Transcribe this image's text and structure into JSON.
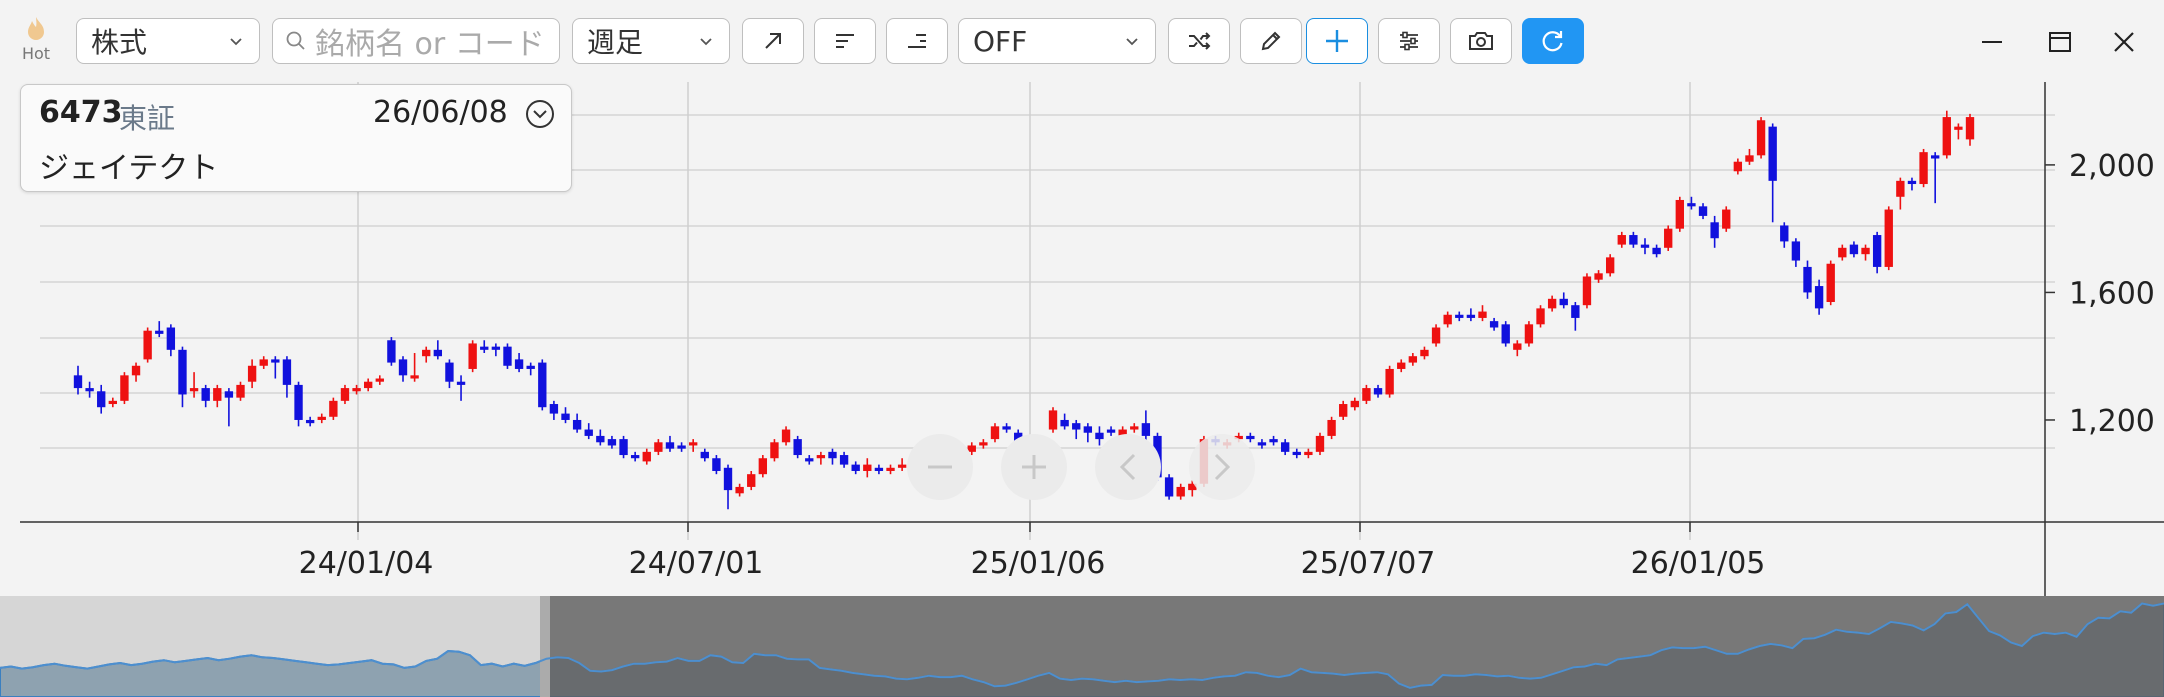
{
  "toolbar": {
    "hot_label": "Hot",
    "market_select": "株式",
    "search_placeholder": "銘柄名 or コード",
    "period_select": "週足",
    "indicator_select": "OFF"
  },
  "info_card": {
    "code": "6473",
    "market": "東証",
    "date": "26/06/08",
    "name": "ジェイテクト"
  },
  "colors": {
    "up": "#ee1111",
    "down": "#1111dd",
    "accent": "#2196f3"
  },
  "chart_data": {
    "type": "candlestick",
    "x_ticks": [
      "24/01/04",
      "24/07/01",
      "25/01/06",
      "25/07/07",
      "26/01/05"
    ],
    "y_ticks": [
      1200,
      1600,
      2000
    ],
    "ylim": [
      880,
      2260
    ],
    "grid": true,
    "candles": [
      {
        "o": 1340,
        "c": 1300,
        "h": 1370,
        "l": 1280
      },
      {
        "o": 1300,
        "c": 1290,
        "h": 1320,
        "l": 1270
      },
      {
        "o": 1290,
        "c": 1240,
        "h": 1310,
        "l": 1220
      },
      {
        "o": 1250,
        "c": 1260,
        "h": 1270,
        "l": 1240
      },
      {
        "o": 1260,
        "c": 1340,
        "h": 1350,
        "l": 1250
      },
      {
        "o": 1340,
        "c": 1370,
        "h": 1380,
        "l": 1320
      },
      {
        "o": 1390,
        "c": 1480,
        "h": 1490,
        "l": 1380
      },
      {
        "o": 1480,
        "c": 1470,
        "h": 1510,
        "l": 1460
      },
      {
        "o": 1490,
        "c": 1420,
        "h": 1500,
        "l": 1400
      },
      {
        "o": 1420,
        "c": 1280,
        "h": 1430,
        "l": 1240
      },
      {
        "o": 1290,
        "c": 1300,
        "h": 1350,
        "l": 1270
      },
      {
        "o": 1300,
        "c": 1260,
        "h": 1310,
        "l": 1240
      },
      {
        "o": 1260,
        "c": 1300,
        "h": 1310,
        "l": 1240
      },
      {
        "o": 1290,
        "c": 1270,
        "h": 1300,
        "l": 1180
      },
      {
        "o": 1270,
        "c": 1310,
        "h": 1320,
        "l": 1260
      },
      {
        "o": 1320,
        "c": 1370,
        "h": 1390,
        "l": 1300
      },
      {
        "o": 1370,
        "c": 1390,
        "h": 1400,
        "l": 1360
      },
      {
        "o": 1390,
        "c": 1380,
        "h": 1400,
        "l": 1330
      },
      {
        "o": 1390,
        "c": 1310,
        "h": 1400,
        "l": 1270
      },
      {
        "o": 1310,
        "c": 1200,
        "h": 1320,
        "l": 1180
      },
      {
        "o": 1200,
        "c": 1190,
        "h": 1210,
        "l": 1180
      },
      {
        "o": 1200,
        "c": 1210,
        "h": 1220,
        "l": 1190
      },
      {
        "o": 1210,
        "c": 1260,
        "h": 1270,
        "l": 1200
      },
      {
        "o": 1260,
        "c": 1300,
        "h": 1310,
        "l": 1250
      },
      {
        "o": 1290,
        "c": 1300,
        "h": 1310,
        "l": 1280
      },
      {
        "o": 1300,
        "c": 1320,
        "h": 1330,
        "l": 1290
      },
      {
        "o": 1320,
        "c": 1330,
        "h": 1340,
        "l": 1310
      },
      {
        "o": 1450,
        "c": 1380,
        "h": 1460,
        "l": 1370
      },
      {
        "o": 1390,
        "c": 1340,
        "h": 1400,
        "l": 1320
      },
      {
        "o": 1330,
        "c": 1340,
        "h": 1410,
        "l": 1320
      },
      {
        "o": 1400,
        "c": 1420,
        "h": 1430,
        "l": 1380
      },
      {
        "o": 1420,
        "c": 1400,
        "h": 1450,
        "l": 1390
      },
      {
        "o": 1380,
        "c": 1320,
        "h": 1390,
        "l": 1300
      },
      {
        "o": 1320,
        "c": 1310,
        "h": 1340,
        "l": 1260
      },
      {
        "o": 1360,
        "c": 1440,
        "h": 1450,
        "l": 1350
      },
      {
        "o": 1430,
        "c": 1420,
        "h": 1450,
        "l": 1410
      },
      {
        "o": 1430,
        "c": 1420,
        "h": 1440,
        "l": 1400
      },
      {
        "o": 1430,
        "c": 1370,
        "h": 1440,
        "l": 1360
      },
      {
        "o": 1390,
        "c": 1360,
        "h": 1410,
        "l": 1350
      },
      {
        "o": 1370,
        "c": 1360,
        "h": 1380,
        "l": 1340
      },
      {
        "o": 1380,
        "c": 1240,
        "h": 1390,
        "l": 1230
      },
      {
        "o": 1250,
        "c": 1220,
        "h": 1260,
        "l": 1200
      },
      {
        "o": 1220,
        "c": 1200,
        "h": 1240,
        "l": 1190
      },
      {
        "o": 1200,
        "c": 1170,
        "h": 1220,
        "l": 1160
      },
      {
        "o": 1170,
        "c": 1150,
        "h": 1190,
        "l": 1140
      },
      {
        "o": 1150,
        "c": 1130,
        "h": 1170,
        "l": 1120
      },
      {
        "o": 1140,
        "c": 1120,
        "h": 1150,
        "l": 1110
      },
      {
        "o": 1140,
        "c": 1090,
        "h": 1150,
        "l": 1080
      },
      {
        "o": 1090,
        "c": 1080,
        "h": 1100,
        "l": 1070
      },
      {
        "o": 1070,
        "c": 1100,
        "h": 1110,
        "l": 1060
      },
      {
        "o": 1100,
        "c": 1130,
        "h": 1140,
        "l": 1090
      },
      {
        "o": 1130,
        "c": 1110,
        "h": 1150,
        "l": 1100
      },
      {
        "o": 1120,
        "c": 1110,
        "h": 1130,
        "l": 1100
      },
      {
        "o": 1120,
        "c": 1130,
        "h": 1140,
        "l": 1100
      },
      {
        "o": 1100,
        "c": 1080,
        "h": 1110,
        "l": 1070
      },
      {
        "o": 1080,
        "c": 1040,
        "h": 1090,
        "l": 1030
      },
      {
        "o": 1050,
        "c": 980,
        "h": 1060,
        "l": 920
      },
      {
        "o": 970,
        "c": 990,
        "h": 1000,
        "l": 960
      },
      {
        "o": 990,
        "c": 1030,
        "h": 1040,
        "l": 980
      },
      {
        "o": 1030,
        "c": 1080,
        "h": 1090,
        "l": 1020
      },
      {
        "o": 1080,
        "c": 1130,
        "h": 1140,
        "l": 1070
      },
      {
        "o": 1130,
        "c": 1170,
        "h": 1180,
        "l": 1120
      },
      {
        "o": 1140,
        "c": 1090,
        "h": 1150,
        "l": 1080
      },
      {
        "o": 1080,
        "c": 1070,
        "h": 1090,
        "l": 1060
      },
      {
        "o": 1080,
        "c": 1090,
        "h": 1100,
        "l": 1060
      },
      {
        "o": 1100,
        "c": 1080,
        "h": 1110,
        "l": 1060
      },
      {
        "o": 1090,
        "c": 1060,
        "h": 1100,
        "l": 1050
      },
      {
        "o": 1060,
        "c": 1040,
        "h": 1070,
        "l": 1030
      },
      {
        "o": 1040,
        "c": 1060,
        "h": 1080,
        "l": 1020
      },
      {
        "o": 1050,
        "c": 1040,
        "h": 1060,
        "l": 1030
      },
      {
        "o": 1040,
        "c": 1050,
        "h": 1060,
        "l": 1030
      },
      {
        "o": 1050,
        "c": 1060,
        "h": 1080,
        "l": 1040
      },
      {
        "o": 1060,
        "c": 1080,
        "h": 1110,
        "l": 1050
      },
      {
        "o": 1080,
        "c": 1070,
        "h": 1090,
        "l": 1060
      },
      {
        "o": 1060,
        "c": 1080,
        "h": 1090,
        "l": 1050
      },
      {
        "o": 1080,
        "c": 1070,
        "h": 1090,
        "l": 1060
      },
      {
        "o": 1060,
        "c": 1100,
        "h": 1110,
        "l": 1050
      },
      {
        "o": 1100,
        "c": 1120,
        "h": 1130,
        "l": 1090
      },
      {
        "o": 1120,
        "c": 1130,
        "h": 1140,
        "l": 1110
      },
      {
        "o": 1140,
        "c": 1180,
        "h": 1190,
        "l": 1130
      },
      {
        "o": 1180,
        "c": 1170,
        "h": 1190,
        "l": 1160
      },
      {
        "o": 1160,
        "c": 1130,
        "h": 1170,
        "l": 1120
      },
      {
        "o": 1130,
        "c": 1110,
        "h": 1140,
        "l": 1100
      },
      {
        "o": 1110,
        "c": 1140,
        "h": 1150,
        "l": 1100
      },
      {
        "o": 1170,
        "c": 1230,
        "h": 1240,
        "l": 1160
      },
      {
        "o": 1200,
        "c": 1180,
        "h": 1220,
        "l": 1170
      },
      {
        "o": 1190,
        "c": 1170,
        "h": 1200,
        "l": 1140
      },
      {
        "o": 1180,
        "c": 1160,
        "h": 1190,
        "l": 1130
      },
      {
        "o": 1160,
        "c": 1140,
        "h": 1180,
        "l": 1120
      },
      {
        "o": 1170,
        "c": 1160,
        "h": 1180,
        "l": 1150
      },
      {
        "o": 1140,
        "c": 1170,
        "h": 1180,
        "l": 1130
      },
      {
        "o": 1170,
        "c": 1180,
        "h": 1190,
        "l": 1160
      },
      {
        "o": 1190,
        "c": 1150,
        "h": 1230,
        "l": 1130
      },
      {
        "o": 1150,
        "c": 1020,
        "h": 1160,
        "l": 1010
      },
      {
        "o": 1020,
        "c": 960,
        "h": 1030,
        "l": 950
      },
      {
        "o": 960,
        "c": 990,
        "h": 1000,
        "l": 950
      },
      {
        "o": 980,
        "c": 1000,
        "h": 1010,
        "l": 960
      },
      {
        "o": 1000,
        "c": 1140,
        "h": 1150,
        "l": 990
      },
      {
        "o": 1140,
        "c": 1130,
        "h": 1150,
        "l": 1120
      },
      {
        "o": 1120,
        "c": 1130,
        "h": 1140,
        "l": 1110
      },
      {
        "o": 1140,
        "c": 1150,
        "h": 1160,
        "l": 1130
      },
      {
        "o": 1150,
        "c": 1140,
        "h": 1160,
        "l": 1130
      },
      {
        "o": 1130,
        "c": 1120,
        "h": 1140,
        "l": 1110
      },
      {
        "o": 1140,
        "c": 1130,
        "h": 1150,
        "l": 1120
      },
      {
        "o": 1130,
        "c": 1100,
        "h": 1140,
        "l": 1090
      },
      {
        "o": 1100,
        "c": 1090,
        "h": 1110,
        "l": 1080
      },
      {
        "o": 1090,
        "c": 1100,
        "h": 1110,
        "l": 1080
      },
      {
        "o": 1100,
        "c": 1150,
        "h": 1160,
        "l": 1090
      },
      {
        "o": 1150,
        "c": 1200,
        "h": 1210,
        "l": 1140
      },
      {
        "o": 1210,
        "c": 1250,
        "h": 1260,
        "l": 1200
      },
      {
        "o": 1240,
        "c": 1260,
        "h": 1270,
        "l": 1230
      },
      {
        "o": 1260,
        "c": 1300,
        "h": 1310,
        "l": 1250
      },
      {
        "o": 1300,
        "c": 1280,
        "h": 1310,
        "l": 1270
      },
      {
        "o": 1280,
        "c": 1360,
        "h": 1370,
        "l": 1270
      },
      {
        "o": 1360,
        "c": 1380,
        "h": 1390,
        "l": 1350
      },
      {
        "o": 1380,
        "c": 1400,
        "h": 1410,
        "l": 1370
      },
      {
        "o": 1400,
        "c": 1420,
        "h": 1430,
        "l": 1390
      },
      {
        "o": 1440,
        "c": 1490,
        "h": 1500,
        "l": 1430
      },
      {
        "o": 1500,
        "c": 1530,
        "h": 1540,
        "l": 1490
      },
      {
        "o": 1530,
        "c": 1520,
        "h": 1540,
        "l": 1510
      },
      {
        "o": 1530,
        "c": 1520,
        "h": 1550,
        "l": 1510
      },
      {
        "o": 1520,
        "c": 1540,
        "h": 1560,
        "l": 1510
      },
      {
        "o": 1510,
        "c": 1490,
        "h": 1520,
        "l": 1480
      },
      {
        "o": 1500,
        "c": 1440,
        "h": 1510,
        "l": 1430
      },
      {
        "o": 1420,
        "c": 1440,
        "h": 1450,
        "l": 1400
      },
      {
        "o": 1440,
        "c": 1500,
        "h": 1510,
        "l": 1430
      },
      {
        "o": 1500,
        "c": 1550,
        "h": 1560,
        "l": 1490
      },
      {
        "o": 1550,
        "c": 1580,
        "h": 1590,
        "l": 1540
      },
      {
        "o": 1580,
        "c": 1560,
        "h": 1600,
        "l": 1550
      },
      {
        "o": 1560,
        "c": 1520,
        "h": 1570,
        "l": 1480
      },
      {
        "o": 1560,
        "c": 1650,
        "h": 1660,
        "l": 1550
      },
      {
        "o": 1640,
        "c": 1660,
        "h": 1670,
        "l": 1630
      },
      {
        "o": 1660,
        "c": 1710,
        "h": 1720,
        "l": 1650
      },
      {
        "o": 1750,
        "c": 1780,
        "h": 1790,
        "l": 1740
      },
      {
        "o": 1780,
        "c": 1750,
        "h": 1790,
        "l": 1740
      },
      {
        "o": 1750,
        "c": 1740,
        "h": 1770,
        "l": 1720
      },
      {
        "o": 1740,
        "c": 1720,
        "h": 1750,
        "l": 1710
      },
      {
        "o": 1740,
        "c": 1800,
        "h": 1810,
        "l": 1730
      },
      {
        "o": 1800,
        "c": 1890,
        "h": 1900,
        "l": 1790
      },
      {
        "o": 1880,
        "c": 1870,
        "h": 1900,
        "l": 1860
      },
      {
        "o": 1870,
        "c": 1840,
        "h": 1880,
        "l": 1830
      },
      {
        "o": 1820,
        "c": 1770,
        "h": 1840,
        "l": 1740
      },
      {
        "o": 1800,
        "c": 1860,
        "h": 1870,
        "l": 1790
      },
      {
        "o": 1980,
        "c": 2010,
        "h": 2020,
        "l": 1970
      },
      {
        "o": 2010,
        "c": 2030,
        "h": 2050,
        "l": 2000
      },
      {
        "o": 2030,
        "c": 2140,
        "h": 2150,
        "l": 2020
      },
      {
        "o": 2120,
        "c": 1950,
        "h": 2130,
        "l": 1820
      },
      {
        "o": 1810,
        "c": 1760,
        "h": 1820,
        "l": 1740
      },
      {
        "o": 1760,
        "c": 1700,
        "h": 1770,
        "l": 1680
      },
      {
        "o": 1680,
        "c": 1600,
        "h": 1700,
        "l": 1580
      },
      {
        "o": 1620,
        "c": 1550,
        "h": 1640,
        "l": 1530
      },
      {
        "o": 1570,
        "c": 1690,
        "h": 1700,
        "l": 1560
      },
      {
        "o": 1710,
        "c": 1740,
        "h": 1750,
        "l": 1700
      },
      {
        "o": 1750,
        "c": 1720,
        "h": 1760,
        "l": 1710
      },
      {
        "o": 1720,
        "c": 1740,
        "h": 1750,
        "l": 1700
      },
      {
        "o": 1780,
        "c": 1680,
        "h": 1790,
        "l": 1660
      },
      {
        "o": 1680,
        "c": 1860,
        "h": 1870,
        "l": 1670
      },
      {
        "o": 1900,
        "c": 1950,
        "h": 1960,
        "l": 1860
      },
      {
        "o": 1950,
        "c": 1940,
        "h": 1960,
        "l": 1920
      },
      {
        "o": 1940,
        "c": 2040,
        "h": 2050,
        "l": 1930
      },
      {
        "o": 2030,
        "c": 2020,
        "h": 2040,
        "l": 1880
      },
      {
        "o": 2030,
        "c": 2150,
        "h": 2170,
        "l": 2020
      },
      {
        "o": 2110,
        "c": 2120,
        "h": 2130,
        "l": 2080
      },
      {
        "o": 2080,
        "c": 2150,
        "h": 2160,
        "l": 2060
      }
    ]
  }
}
